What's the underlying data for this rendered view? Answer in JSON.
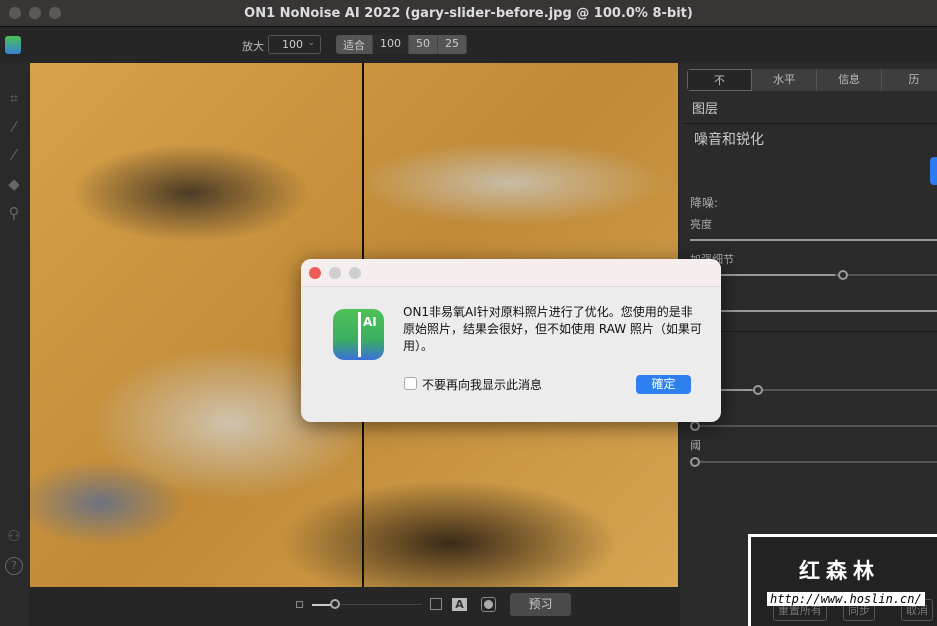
{
  "window": {
    "title": "ON1 NoNoise AI 2022 (gary-slider-before.jpg @ 100.0% 8-bit)"
  },
  "toolbar": {
    "zoom_label": "放大",
    "zoom_value": "100",
    "zoom_presets": [
      "适合",
      "100",
      "50",
      "25"
    ]
  },
  "panel": {
    "tabs": [
      "不",
      "水平",
      "信息",
      "历"
    ],
    "layers_title": "图层",
    "section_title": "噪音和锐化",
    "noise_label": "降噪:",
    "brightness_label": "亮度",
    "detail_label": "加强细节",
    "threshold_label": "阈"
  },
  "bottom": {
    "preview_label": "预习",
    "reset_all": "重置所有",
    "sync": "同步",
    "cancel": "取消"
  },
  "dialog": {
    "message": "ON1非易氧AI针对原料照片进行了优化。您使用的是非原始照片，结果会很好，但不如使用 RAW 照片（如果可用）。",
    "checkbox_label": "不要再向我显示此消息",
    "ok_label": "確定",
    "icon_text": "AI"
  },
  "watermark": {
    "name": "红森林",
    "url": "http://www.hoslin.cn/"
  }
}
